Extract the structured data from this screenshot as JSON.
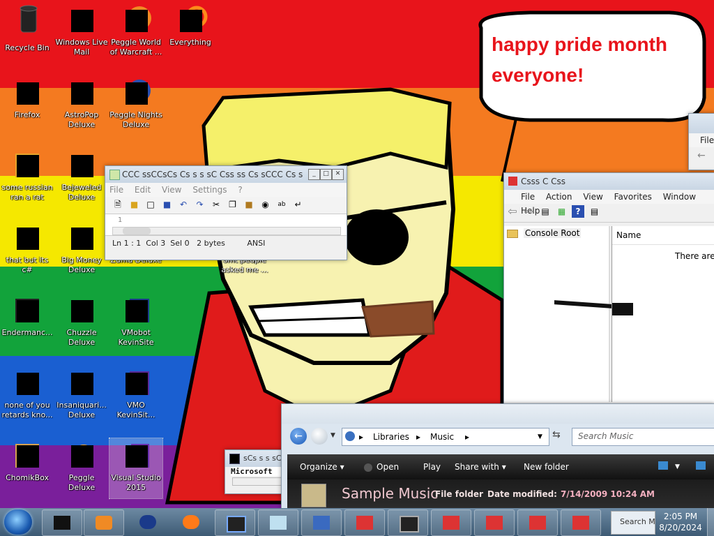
{
  "speech_bubble": {
    "line1": "happy pride month",
    "line2": "everyone!"
  },
  "desktop_icons": [
    {
      "label": "Recycle Bin"
    },
    {
      "label": "Windows Live Mail"
    },
    {
      "label": "Peggle World of Warcraft ..."
    },
    {
      "label": "Everything"
    },
    {
      "label": "Firefox"
    },
    {
      "label": "AstroPop Deluxe"
    },
    {
      "label": "Peggle Nights Deluxe"
    },
    {
      "label": "some russian ran a rat"
    },
    {
      "label": "Bejeweled Deluxe"
    },
    {
      "label": "that but its c#"
    },
    {
      "label": "Big Money Deluxe"
    },
    {
      "label": "Zuma Deluxe"
    },
    {
      "label": "smt people asked me ..."
    },
    {
      "label": "Endermanc..."
    },
    {
      "label": "Chuzzle Deluxe"
    },
    {
      "label": "VMobot KevinSite"
    },
    {
      "label": "none of you retards kno..."
    },
    {
      "label": "Insaniquari... Deluxe"
    },
    {
      "label": "VMO KevinSit..."
    },
    {
      "label": "ChomikBox"
    },
    {
      "label": "Peggle Deluxe"
    },
    {
      "label": "Visual Studio 2015"
    }
  ],
  "notepad": {
    "title": "CCC ssCCsCs Cs s s sC Css ss Cs sCCC   Cs  s",
    "menu": [
      "File",
      "Edit",
      "View",
      "Settings",
      "?"
    ],
    "line_number": "1",
    "status": {
      "ln": "Ln 1 : 1",
      "col": "Col 3",
      "sel": "Sel 0",
      "bytes": "2 bytes",
      "encoding": "ANSI"
    }
  },
  "mmc": {
    "title": "Csss C Css",
    "menu": [
      "File",
      "Action",
      "View",
      "Favorites",
      "Window",
      "Help"
    ],
    "tree_root": "Console Root",
    "column_name": "Name",
    "empty_text": "There are n"
  },
  "small_window": {
    "menu_file": "File"
  },
  "explorer": {
    "breadcrumb": [
      "Libraries",
      "Music"
    ],
    "search_placeholder": "Search Music",
    "toolbar": [
      "Organize",
      "Open",
      "Play",
      "Share with",
      "New folder"
    ],
    "details": {
      "name": "Sample Music",
      "type": "File folder",
      "modified_label": "Date modified:",
      "modified_value": "7/14/2009 10:24 AM"
    }
  },
  "console_window": {
    "title": "sCs s s sC",
    "text": "Microsoft"
  },
  "taskbar": {
    "search_text": "Search M",
    "clock_time": "2:05 PM",
    "clock_date": "8/20/2024"
  },
  "colors": {
    "pride_red": "#e8141b",
    "pride_orange": "#f47a20",
    "pride_yellow": "#f5e800",
    "pride_green": "#12a33b",
    "pride_blue": "#1a5fd1",
    "pride_purple": "#7a1f9b",
    "bubble_text": "#e8141b"
  }
}
